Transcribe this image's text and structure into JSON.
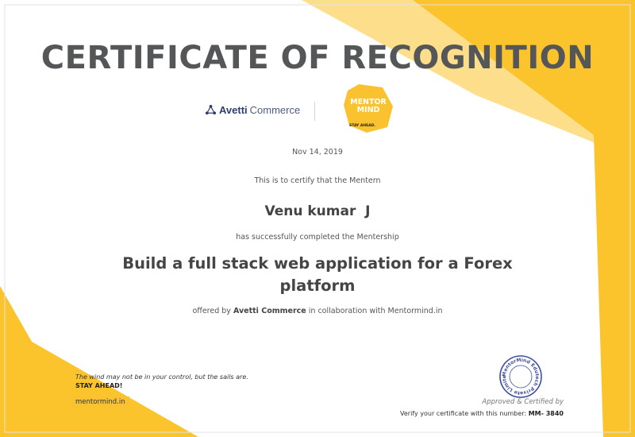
{
  "certificate": {
    "title": "CERTIFICATE OF RECOGNITION",
    "date": "Nov 14, 2019",
    "certify_text": "This is to certify that the Mentern",
    "recipient": "Venu kumar  J",
    "completed_text": "has successfully completed the Mentership",
    "project": "Build a full stack web application for a Forex platform",
    "offered_prefix": "offered by",
    "offered_company": "Avetti Commerce",
    "offered_suffix": "in collaboration with Mentormind.in"
  },
  "logos": {
    "avetti": {
      "name_bold": "Avetti",
      "name_rest": "Commerce",
      "icon": "network-nodes-icon"
    },
    "mentormind": {
      "line1": "MENTOR",
      "line2": "MIND",
      "tagline": "STAY AHEAD."
    }
  },
  "footer": {
    "motto": "The wind may not be in your control, but the sails are.",
    "motto_strong": "STAY AHEAD!",
    "site": "mentormind.in",
    "seal_text": "MentorMind Edutech Private Limited",
    "approved": "Approved & Certified by",
    "verify_prefix": "Verify your certificate with this number:",
    "verify_number": "MM- 3840"
  },
  "colors": {
    "accent_yellow": "#fbc42c",
    "title_gray": "#555658",
    "avetti_navy": "#2f3f6b",
    "seal_blue": "#3f4f9c"
  }
}
